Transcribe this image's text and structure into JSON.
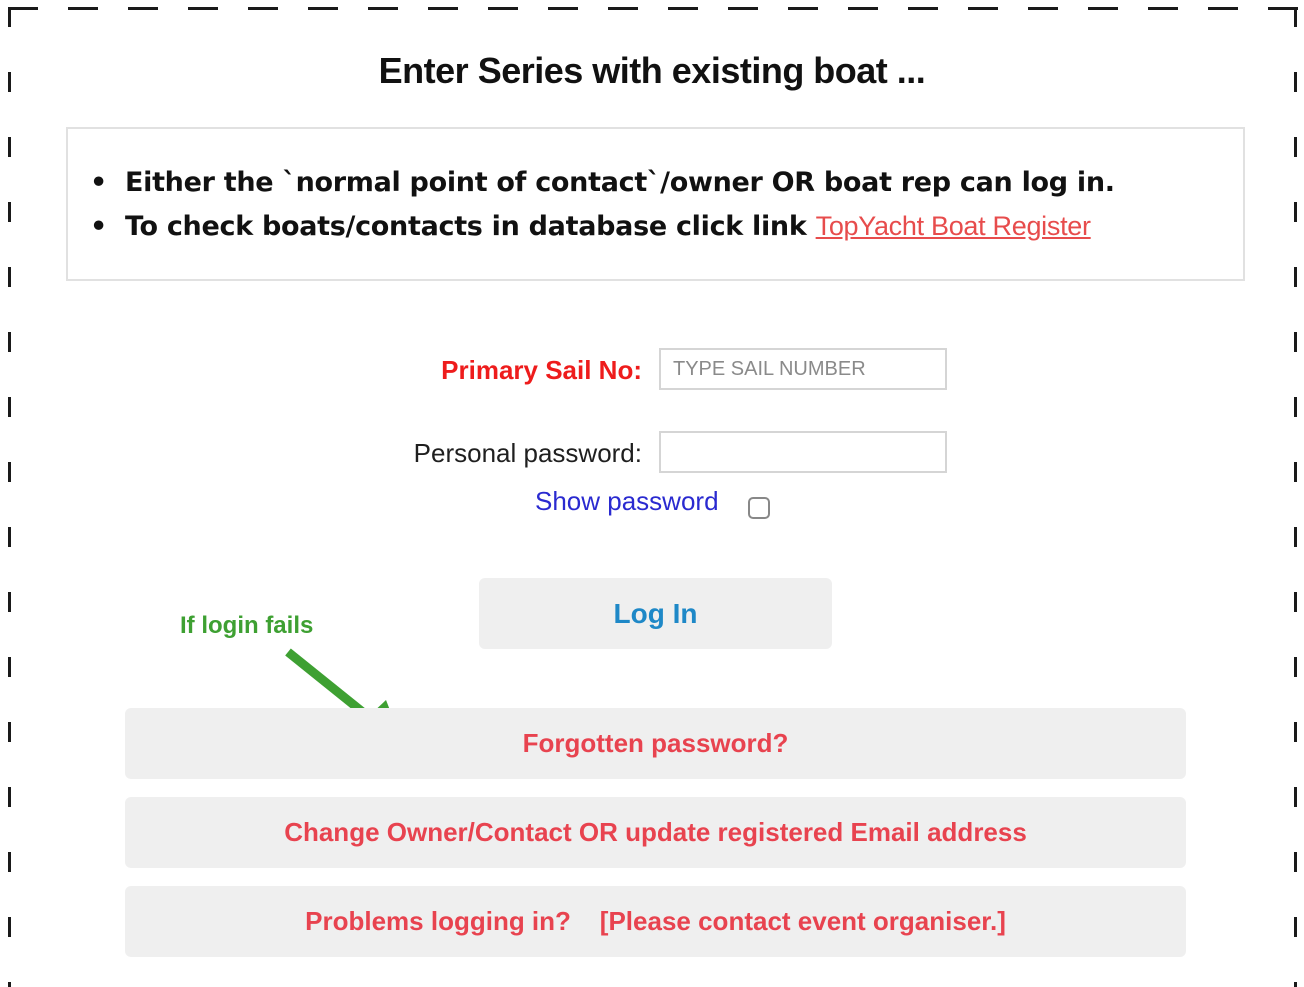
{
  "page": {
    "title": "Enter Series with existing boat ..."
  },
  "notice": {
    "line1": "Either the `normal point of contact`/owner OR boat rep can log in.",
    "line2_text": "To check boats/contacts in database click link ",
    "line2_link": "TopYacht Boat Register"
  },
  "form": {
    "sail_label": "Primary Sail No:",
    "sail_placeholder": "TYPE SAIL NUMBER",
    "sail_value": "",
    "password_label": "Personal password:",
    "password_value": "",
    "show_password_label": "Show password",
    "show_password_checked": false
  },
  "buttons": {
    "login": "Log In",
    "forgotten": "Forgotten password?",
    "change_owner": "Change Owner/Contact OR update registered Email address",
    "problems": "Problems logging in?    [Please contact event organiser.]"
  },
  "annotation": {
    "text": "If login fails",
    "color": "#3ea032",
    "icon": "arrow-down-right-icon"
  },
  "colors": {
    "sail_label": "#ee1c1c",
    "login_text": "#1e88c7",
    "help_button_text": "#e8434f",
    "link": "#e74c4c",
    "show_password": "#2a2ad0"
  }
}
